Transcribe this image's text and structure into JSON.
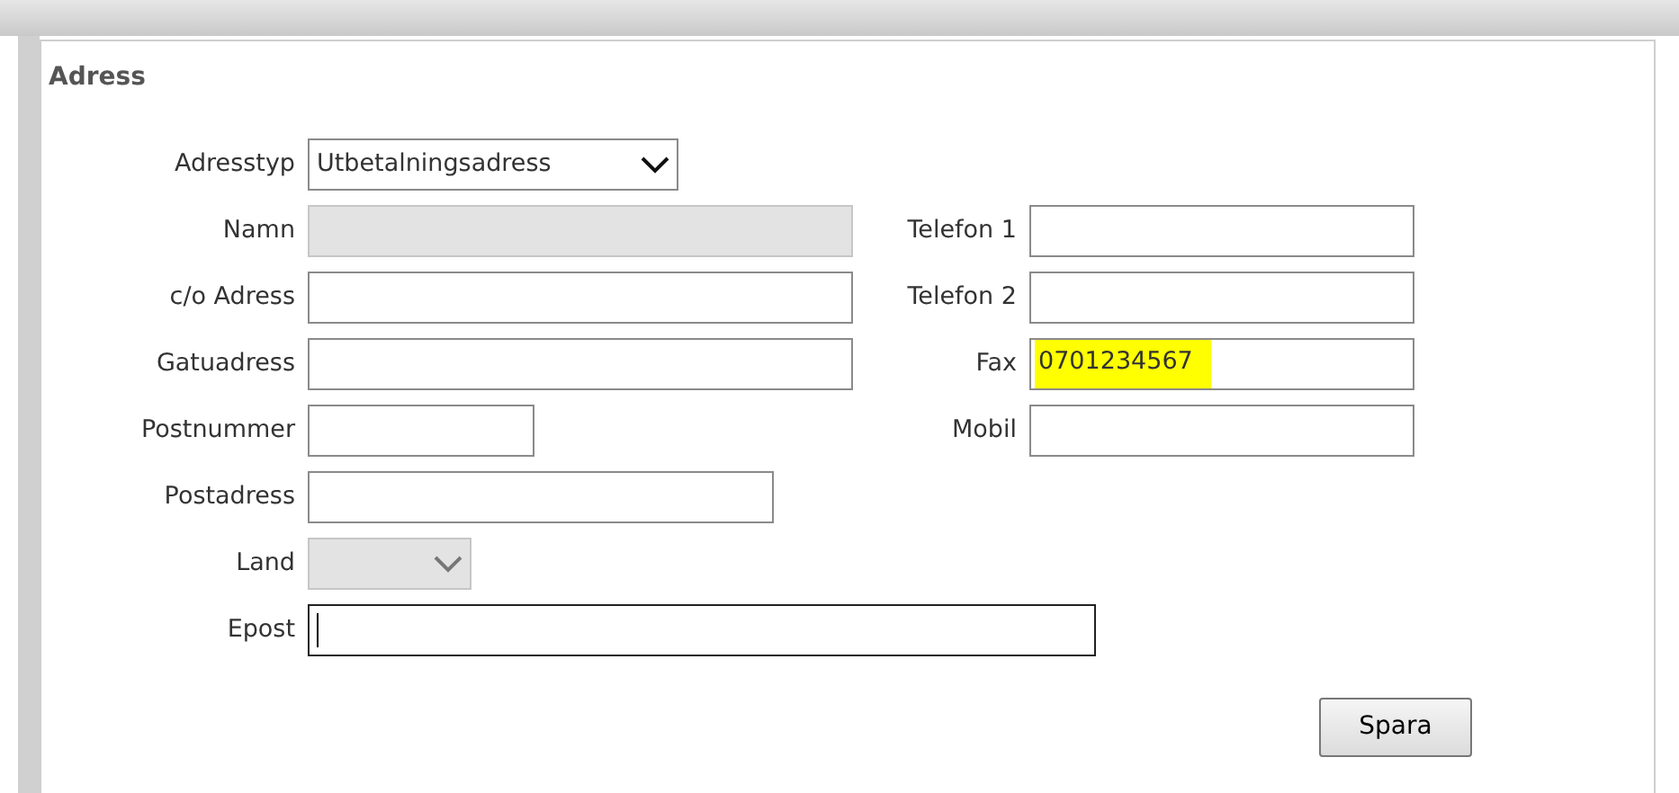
{
  "panel": {
    "title": "Adress"
  },
  "left_fields": [
    {
      "kind": "select",
      "label": "Adresstyp",
      "value": "Utbetalningsadress",
      "disabled": false,
      "focused": false
    },
    {
      "kind": "text",
      "label": "Namn",
      "disabled": true,
      "focused": false
    },
    {
      "kind": "text",
      "label": "c/o Adress",
      "disabled": false,
      "focused": false
    },
    {
      "kind": "text",
      "label": "Gatuadress",
      "disabled": false,
      "focused": false
    },
    {
      "kind": "text",
      "label": "Postnummer",
      "disabled": false,
      "focused": false
    },
    {
      "kind": "text",
      "label": "Postadress",
      "disabled": false,
      "focused": false
    },
    {
      "kind": "select",
      "label": "Land",
      "disabled": true,
      "focused": false
    },
    {
      "kind": "text",
      "label": "Epost",
      "disabled": false,
      "focused": true
    }
  ],
  "right_fields": [
    {
      "kind": "text",
      "label": "Telefon 1"
    },
    {
      "kind": "text",
      "label": "Telefon 2"
    },
    {
      "kind": "text",
      "label": "Fax",
      "value": "0701234567",
      "highlighted": true
    },
    {
      "kind": "text",
      "label": "Mobil"
    }
  ],
  "save_button": "Spara"
}
